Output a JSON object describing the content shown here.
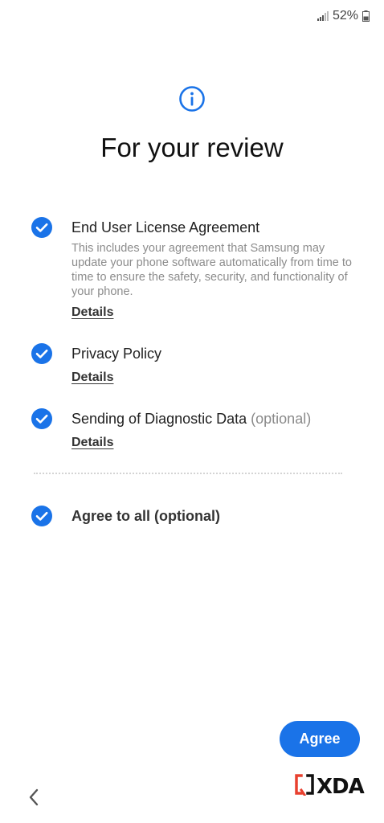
{
  "status_bar": {
    "signal_icon": "signal-bars-icon",
    "battery_percent": "52%",
    "battery_icon": "battery-icon",
    "battery_level": 0.52
  },
  "header": {
    "icon": "info-icon",
    "title": "For your review"
  },
  "items": [
    {
      "title": "End User License Agreement",
      "optional_suffix": "",
      "description": "This includes your agreement that Samsung may update your phone software automatically from time to time to ensure the safety, security, and functionality of your phone.",
      "details_label": "Details",
      "checked": true
    },
    {
      "title": "Privacy Policy",
      "optional_suffix": "",
      "description": "",
      "details_label": "Details",
      "checked": true
    },
    {
      "title": "Sending of Diagnostic Data",
      "optional_suffix": "(optional)",
      "description": "",
      "details_label": "Details",
      "checked": true
    }
  ],
  "agree_all": {
    "label": "Agree to all (optional)",
    "checked": true
  },
  "footer": {
    "agree_button_label": "Agree",
    "back_icon": "chevron-left-icon"
  },
  "watermark": {
    "text": "XDA"
  },
  "colors": {
    "accent": "#1a73e8",
    "check_fill": "#1a73e8",
    "description_text": "#8c8c8c"
  }
}
